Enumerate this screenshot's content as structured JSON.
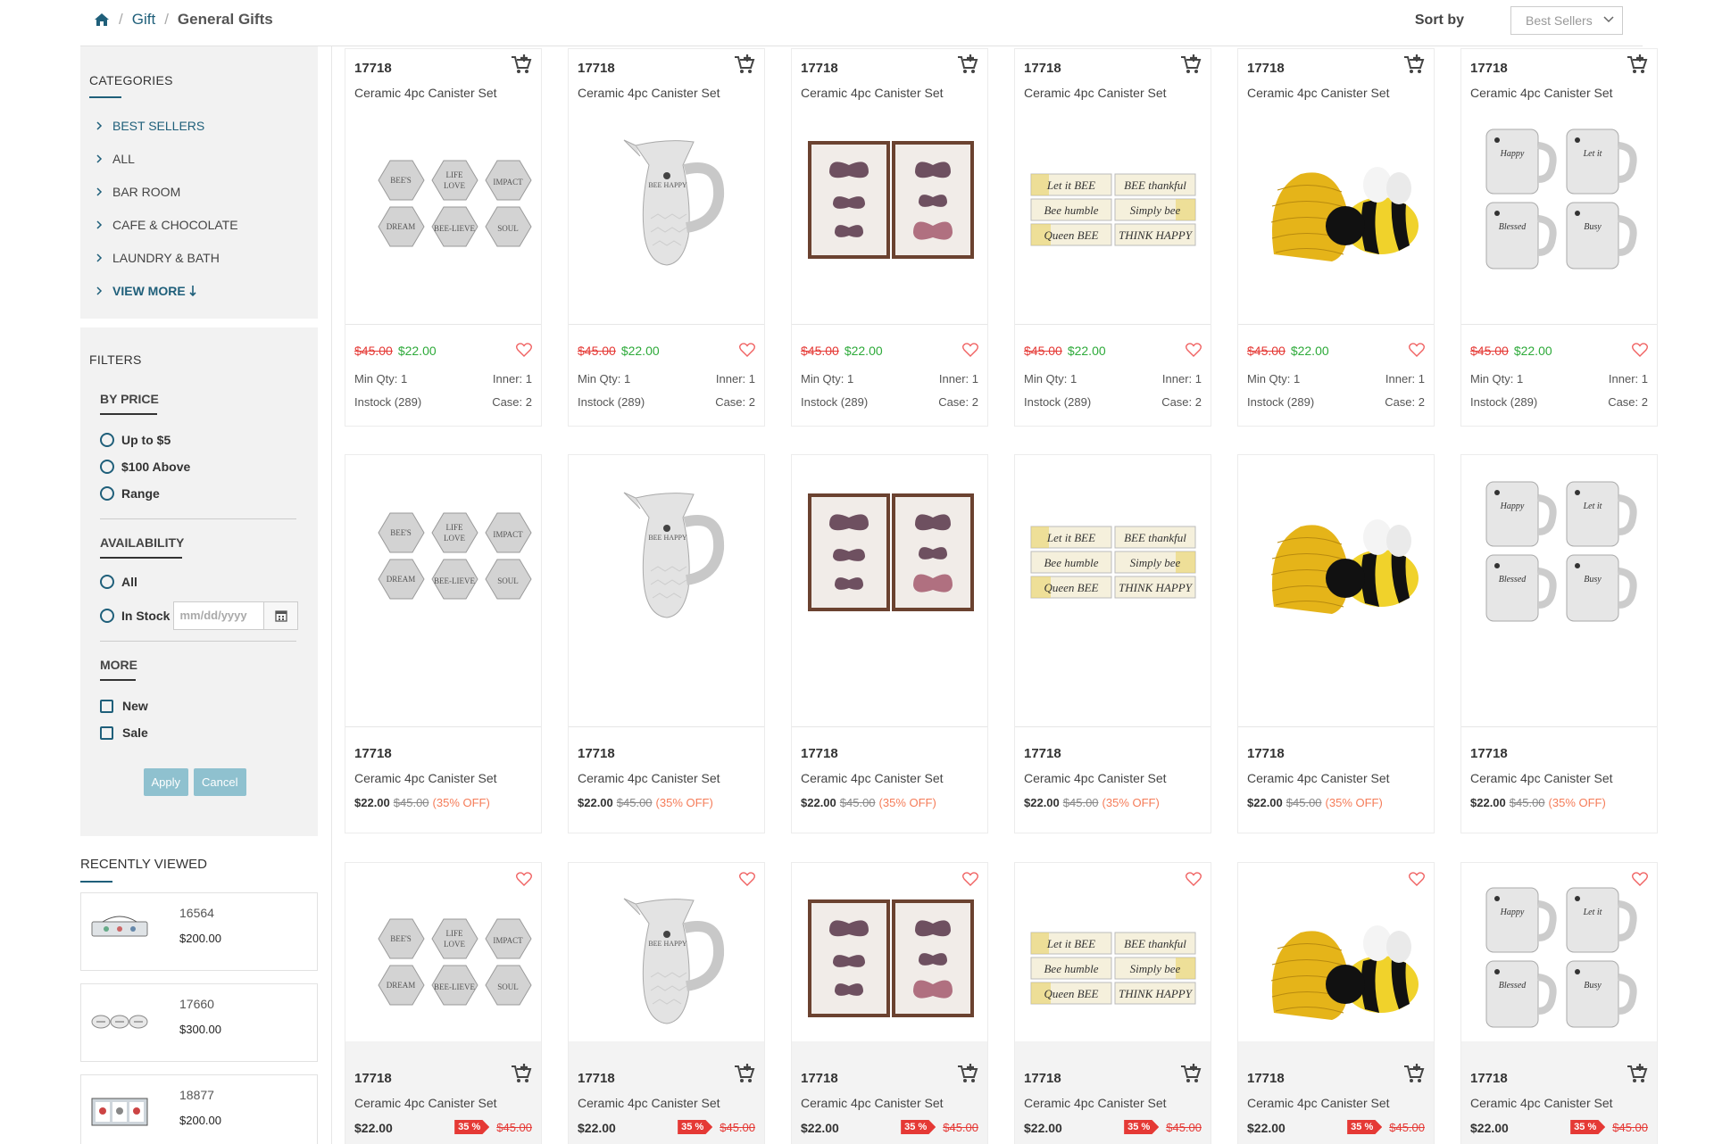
{
  "breadcrumb": {
    "items": [
      "Gift",
      "General Gifts"
    ]
  },
  "sort": {
    "label": "Sort by",
    "selected": "Best Sellers"
  },
  "categories": {
    "title": "CATEGORIES",
    "items": [
      "BEST SELLERS",
      "ALL",
      "BAR ROOM",
      "CAFE & CHOCOLATE",
      "LAUNDRY & BATH"
    ],
    "view_more": "VIEW MORE"
  },
  "filters": {
    "title": "FILTERS",
    "by_price": {
      "title": "BY PRICE",
      "options": [
        "Up to $5",
        "$100 Above",
        "Range"
      ]
    },
    "availability": {
      "title": "AVAILABILITY",
      "options": [
        "All",
        "In Stock"
      ],
      "date_placeholder": "mm/dd/yyyy"
    },
    "more": {
      "title": "MORE",
      "options": [
        "New",
        "Sale"
      ]
    },
    "apply_label": "Apply",
    "cancel_label": "Cancel"
  },
  "recently_viewed": {
    "title": "RECENTLY VIEWED",
    "items": [
      {
        "sku": "16564",
        "price": "$200.00"
      },
      {
        "sku": "17660",
        "price": "$300.00"
      },
      {
        "sku": "18877",
        "price": "$200.00"
      }
    ]
  },
  "product": {
    "sku": "17718",
    "name": "Ceramic 4pc Canister Set",
    "old_price": "$45.00",
    "new_price": "$22.00",
    "min_qty": "Min Qty: 1",
    "inner": "Inner: 1",
    "instock": "Instock (289)",
    "case": "Case: 2",
    "off": "(35% OFF)",
    "badge": "35 %"
  },
  "product_images": [
    "coasters",
    "pitcher",
    "butterflies",
    "bee-signs",
    "beehive-shakers",
    "mugs"
  ],
  "colors": {
    "accent": "#1f5f7a",
    "sale_red": "#e53935",
    "sale_green": "#2eaa3a",
    "off_orange": "#f57c59",
    "button": "#8fc1cf"
  }
}
